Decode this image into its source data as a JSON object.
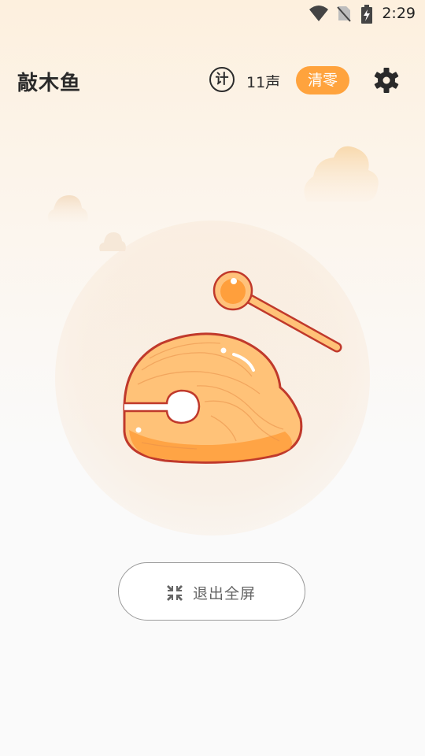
{
  "status_bar": {
    "time": "2:29",
    "icons": [
      "wifi-icon",
      "no-sim-icon",
      "battery-charging-icon"
    ]
  },
  "header": {
    "title": "敲木鱼",
    "counter_icon_label": "计",
    "count": "11声",
    "reset_label": "清零",
    "settings_icon": "gear-icon"
  },
  "main": {
    "exit_fullscreen_label": "退出全屏",
    "exit_icon": "collapse-icon"
  },
  "colors": {
    "accent": "#ffa33d",
    "fish_fill": "#ffc078",
    "fish_outline": "#c0392b"
  }
}
